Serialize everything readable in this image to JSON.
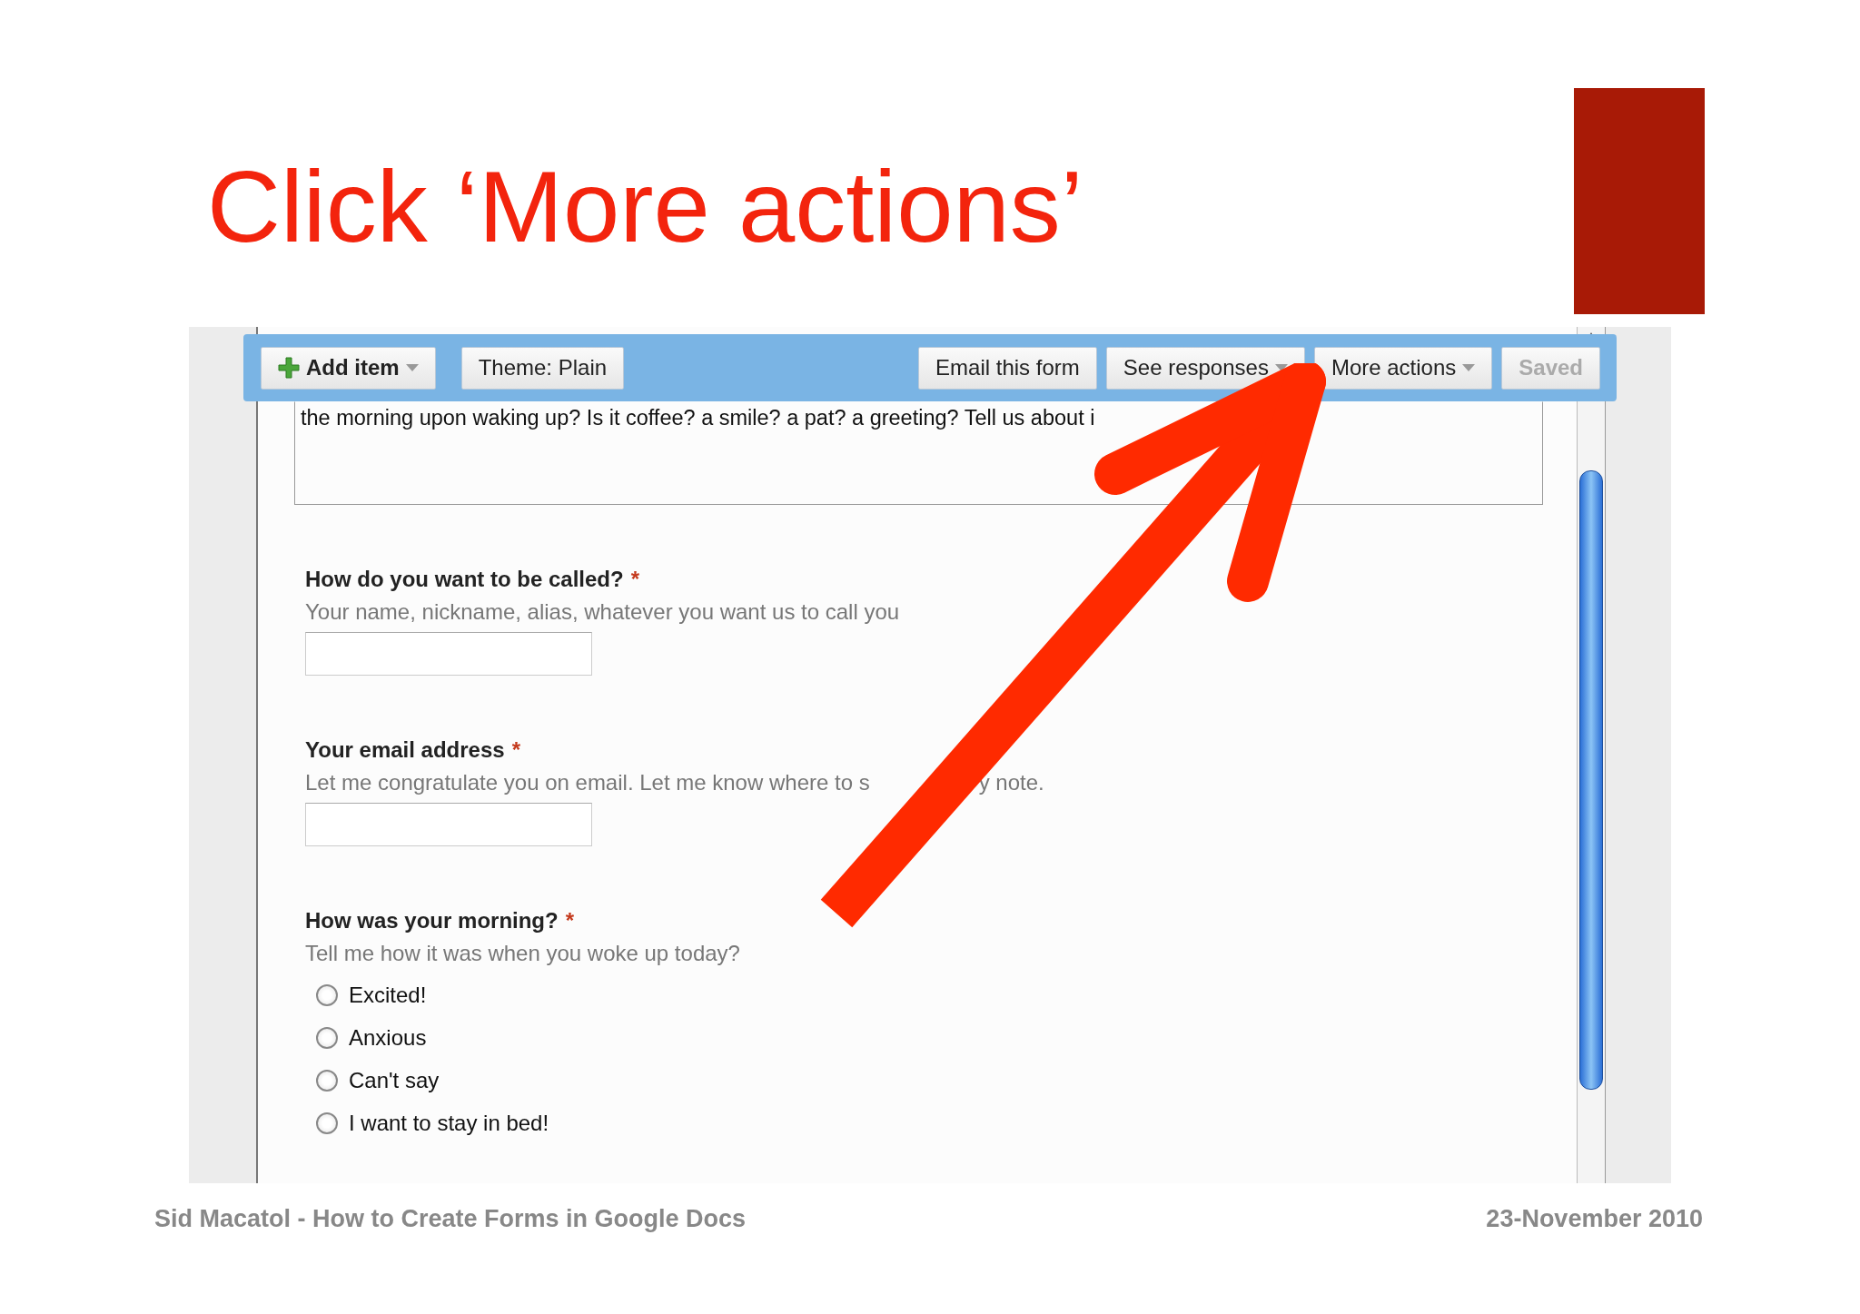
{
  "slide_title": "Click ‘More actions’",
  "toolbar": {
    "buttons": [
      {
        "kind": "add",
        "label": "Add item",
        "dropdown": true,
        "disabled": false
      },
      {
        "kind": "plain",
        "label": "Theme:  Plain",
        "dropdown": false,
        "disabled": false
      },
      {
        "kind": "spacer"
      },
      {
        "kind": "plain",
        "label": "Email this form",
        "dropdown": false,
        "disabled": false
      },
      {
        "kind": "plain",
        "label": "See responses",
        "dropdown": true,
        "disabled": false
      },
      {
        "kind": "plain",
        "label": "More actions",
        "dropdown": true,
        "disabled": false
      },
      {
        "kind": "plain",
        "label": "Saved",
        "dropdown": false,
        "disabled": true
      }
    ]
  },
  "form_description": [
    [
      "the morning upon waking up? Is it coffee? a smile? a pat? a greeting? Tell us about i"
    ]
  ],
  "questions": [
    {
      "kind": "text",
      "title": "How do you want to be called?",
      "required_mark": "*",
      "help": [
        "Your name, nickname, alias, whatever you want us to call you"
      ]
    },
    {
      "kind": "text",
      "title": "Your email address",
      "required_mark": "*",
      "help": [
        "Let me congratulate you on email. Let me know where to s",
        "y note."
      ]
    },
    {
      "kind": "choice",
      "title": "How was your morning?",
      "required_mark": "*",
      "help": [
        "Tell me how it was when you woke up today?"
      ],
      "options": [
        {
          "label": "Excited!",
          "selected": false
        },
        {
          "label": "Anxious",
          "selected": false
        },
        {
          "label": "Can't say",
          "selected": false
        },
        {
          "label": "I want to stay in bed!",
          "selected": false
        }
      ]
    }
  ],
  "footer": {
    "left": "Sid Macatol - How to Create Forms in Google Docs",
    "right": "23-November 2010"
  }
}
